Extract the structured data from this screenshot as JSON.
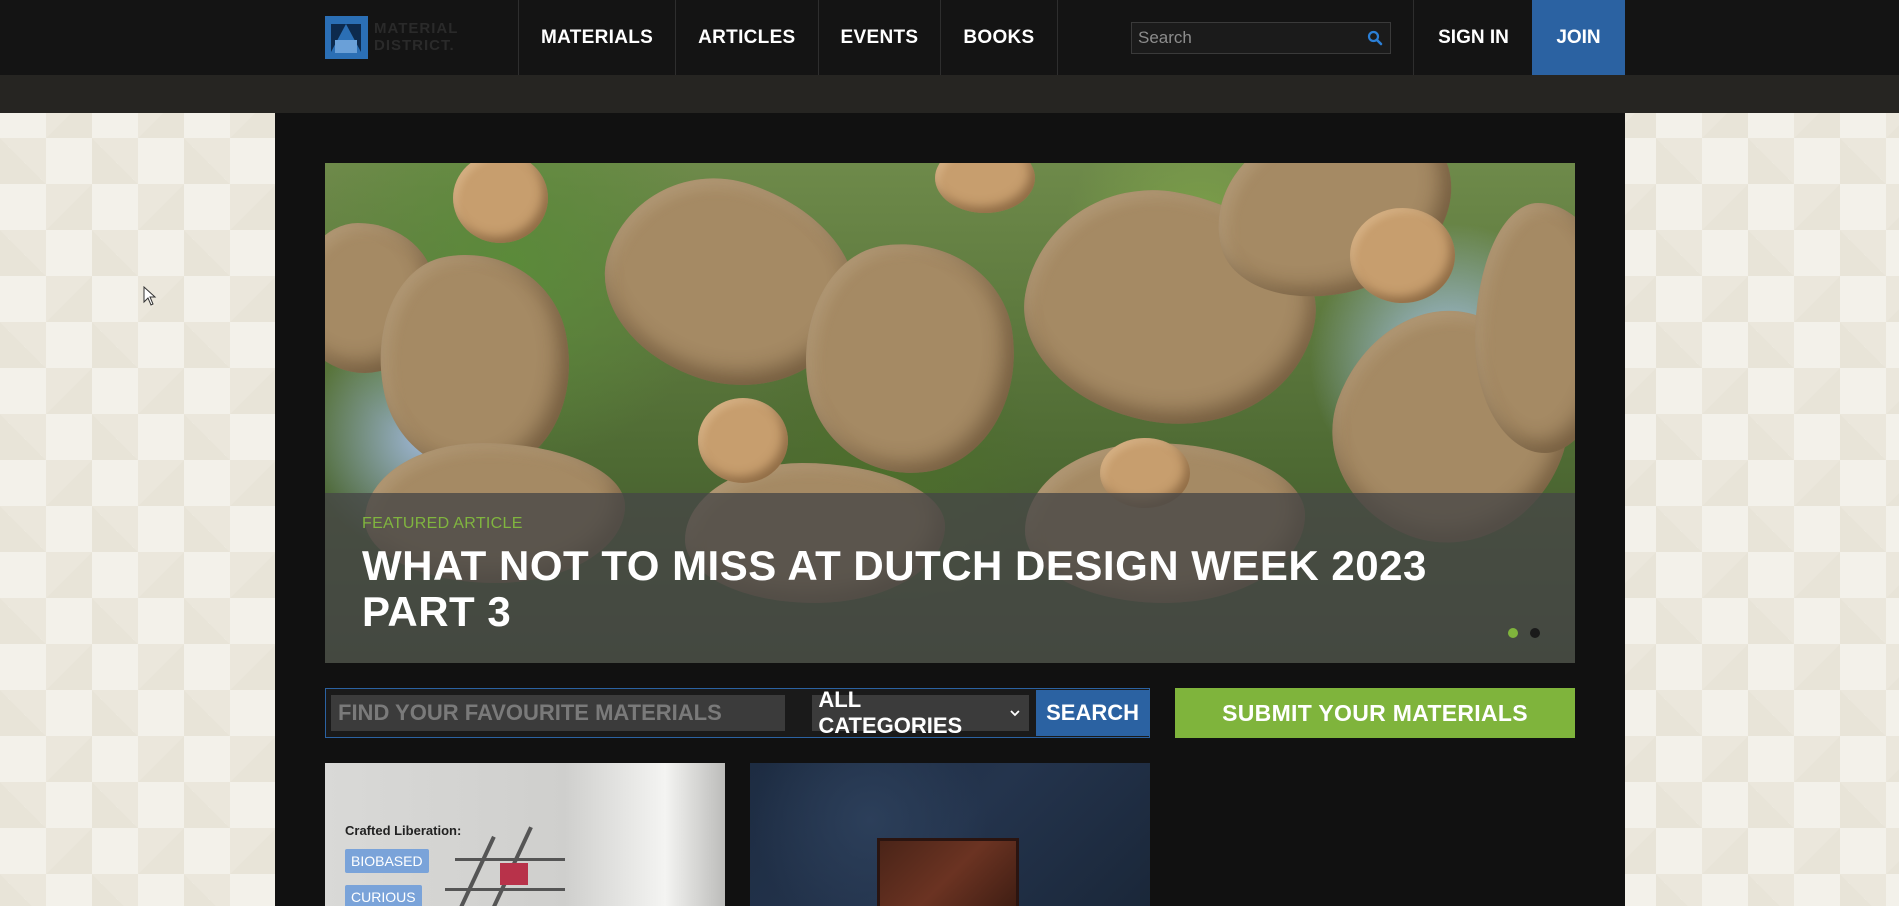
{
  "header": {
    "logo_text_line1": "MATERIAL",
    "logo_text_line2": "DISTRICT.",
    "nav": [
      "MATERIALS",
      "ARTICLES",
      "EVENTS",
      "BOOKS"
    ],
    "search_placeholder": "Search",
    "sign_in": "SIGN IN",
    "join": "JOIN"
  },
  "hero": {
    "label": "FEATURED ARTICLE",
    "title": "WHAT NOT TO MISS AT DUTCH DESIGN WEEK 2023 PART 3",
    "slides": 2,
    "active_slide": 1
  },
  "material_search": {
    "placeholder": "FIND YOUR FAVOURITE MATERIALS",
    "category": "ALL CATEGORIES",
    "search_label": "SEARCH"
  },
  "submit": {
    "label": "SUBMIT YOUR MATERIALS"
  },
  "cards": [
    {
      "caption": "Crafted Liberation:",
      "tags": [
        "BIOBASED",
        "CURIOUS"
      ]
    },
    {
      "caption": "",
      "tags": []
    }
  ],
  "colors": {
    "accent_blue": "#2b62a2",
    "accent_green": "#7fb43c",
    "nav_bg": "#141414",
    "main_bg": "#111111"
  }
}
